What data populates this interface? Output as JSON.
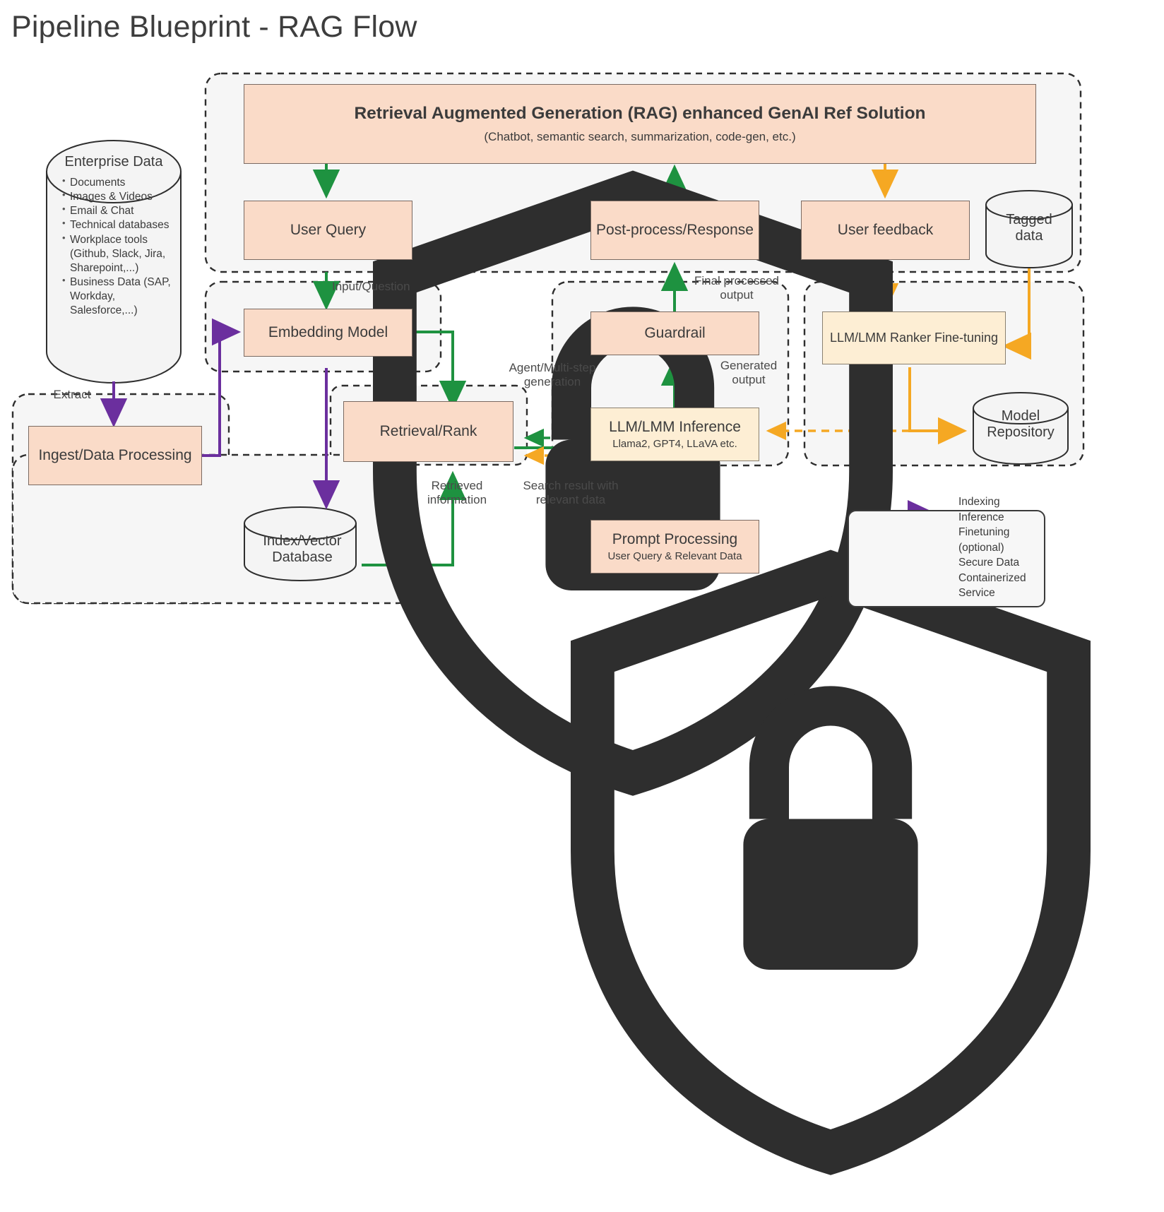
{
  "page": {
    "title": "Pipeline Blueprint - RAG Flow"
  },
  "colors": {
    "indexing": "#6b2f9e",
    "inference": "#1e9240",
    "finetuning": "#f5a823",
    "node_fill": "#fadbc8",
    "model_fill": "#fdeed4",
    "group_fill": "#f6f6f6",
    "stroke": "#3b3b3b"
  },
  "enterprise": {
    "title": "Enterprise Data",
    "icon": "secure-shield-icon",
    "items": [
      "Documents",
      "Images & Videos",
      "Email & Chat",
      "Technical databases",
      "Workplace tools (Github, Slack, Jira, Sharepoint,...)",
      "Business Data (SAP, Workday, Salesforce,...)"
    ]
  },
  "nodes": {
    "rag_banner": {
      "title": "Retrieval Augmented Generation (RAG) enhanced GenAI Ref Solution",
      "subtitle": "(Chatbot, semantic search, summarization, code-gen, etc.)"
    },
    "user_query": "User Query",
    "post_process": "Post-process/Response",
    "user_feedback": "User feedback",
    "embedding_model": "Embedding Model",
    "guardrail": "Guardrail",
    "ranker_finetune": "LLM/LMM Ranker Fine-tuning",
    "retrieval_rank": "Retrieval/Rank",
    "llm_inference": {
      "title": "LLM/LMM Inference",
      "subtitle": "Llama2, GPT4, LLaVA etc."
    },
    "ingest": "Ingest/Data Processing",
    "prompt_processing": {
      "title": "Prompt Processing",
      "subtitle": "User Query & Relevant Data"
    }
  },
  "cylinders": {
    "tagged_data": "Tagged data",
    "model_repository": "Model Repository",
    "index_vector_db": "Index/Vector Database"
  },
  "edge_labels": {
    "extract": "Extract",
    "input_question": "Input/Question",
    "final_processed_output": "Final processed output",
    "generated_output": "Generated output",
    "agent_multistep": "Agent/Multi-step generation",
    "retrieved_information": "Retrieved information",
    "search_result": "Search result with relevant data"
  },
  "legend": {
    "items": [
      {
        "label": "Indexing",
        "type": "arrow",
        "color": "#6b2f9e"
      },
      {
        "label": "Inference",
        "type": "arrow",
        "color": "#1e9240"
      },
      {
        "label": "Finetuning (optional)",
        "type": "arrow",
        "color": "#f5a823"
      },
      {
        "label": "Secure Data",
        "type": "shield-icon",
        "color": "#3b3b3b"
      },
      {
        "label": "Containerized Service",
        "type": "dashed-box",
        "color": "#3b3b3b"
      }
    ],
    "lines": [
      "Indexing",
      "Inference",
      "Finetuning",
      "(optional)",
      "Secure Data",
      "Containerized",
      "Service"
    ]
  }
}
